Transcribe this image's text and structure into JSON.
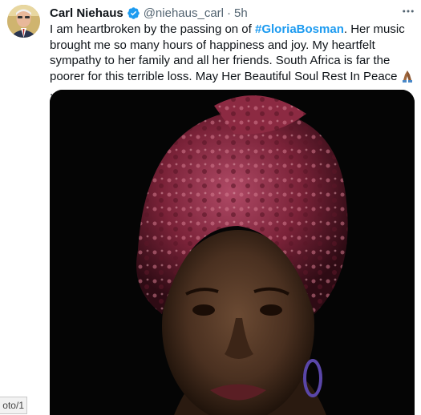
{
  "tweet": {
    "author_name": "Carl Niehaus",
    "handle": "@niehaus_carl",
    "separator": "·",
    "time": "5h",
    "text_before": "I am heartbroken by the passing on of ",
    "hashtag": "#GloriaBosman",
    "text_after": ". Her music brought me so many hours of happiness and joy. My heartfelt sympathy to her family and all her friends. South Africa is far the poorer for this terrible loss. May Her Beautiful Soul Rest In Peace ",
    "text_end": ".",
    "emoji": "folded-hands-icon",
    "media_alt": "Portrait of woman wearing pink headwrap"
  },
  "overlay": {
    "photo_label": "oto/1"
  },
  "colors": {
    "hashtag": "#1d9bf0",
    "verified": "#1d9bf0",
    "secondary_text": "#536471"
  }
}
